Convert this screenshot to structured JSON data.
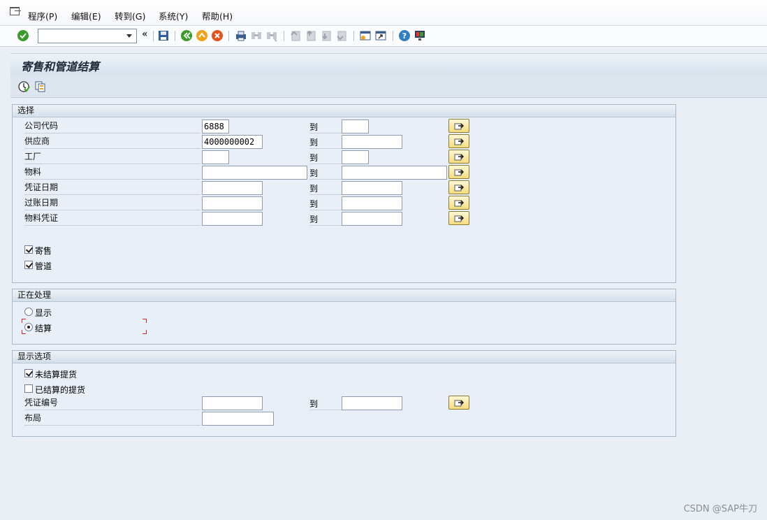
{
  "menu": [
    "程序(P)",
    "编辑(E)",
    "转到(G)",
    "系统(Y)",
    "帮助(H)"
  ],
  "toolbar": {
    "command_field_value": "",
    "icons": [
      "enter-icon",
      "command-dropdown-icon",
      "collapse-icon",
      "save-icon",
      "back-icon",
      "exit-icon",
      "cancel-icon",
      "print-icon",
      "find-icon",
      "find-next-icon",
      "first-page-icon",
      "previous-page-icon",
      "next-page-icon",
      "last-page-icon",
      "create-session-icon",
      "shortcut-icon",
      "help-icon",
      "customize-layout-icon"
    ]
  },
  "title": "寄售和管道结算",
  "app_toolbar_icons": [
    "execute-icon",
    "get-variant-icon"
  ],
  "selection": {
    "header": "选择",
    "to_label": "到",
    "rows": [
      {
        "label": "公司代码",
        "from": "6888",
        "to": ""
      },
      {
        "label": "供应商",
        "from": "4000000002",
        "to": ""
      },
      {
        "label": "工厂",
        "from": "",
        "to": ""
      },
      {
        "label": "物料",
        "from": "",
        "to": ""
      },
      {
        "label": "凭证日期",
        "from": "",
        "to": ""
      },
      {
        "label": "过账日期",
        "from": "",
        "to": ""
      },
      {
        "label": "物料凭证",
        "from": "",
        "to": ""
      }
    ],
    "checkboxes": [
      {
        "label": "寄售",
        "checked": true
      },
      {
        "label": "管道",
        "checked": true
      }
    ]
  },
  "processing": {
    "header": "正在处理",
    "options": [
      {
        "label": "显示",
        "selected": false
      },
      {
        "label": "结算",
        "selected": true
      }
    ]
  },
  "display_options": {
    "header": "显示选项",
    "checkboxes": [
      {
        "label": "未结算提货",
        "checked": true
      },
      {
        "label": "已结算的提货",
        "checked": false
      }
    ],
    "doc_no_label": "凭证编号",
    "doc_no_from": "",
    "doc_no_to": "",
    "layout_label": "布局",
    "layout_value": ""
  },
  "watermark": "CSDN @SAP牛刀",
  "colors": {
    "multiple_selection_button": "#f5dc7c",
    "enter_icon": "#3a9a2b",
    "help_icon": "#2f7fc1",
    "focus_bracket": "#d3272b"
  }
}
